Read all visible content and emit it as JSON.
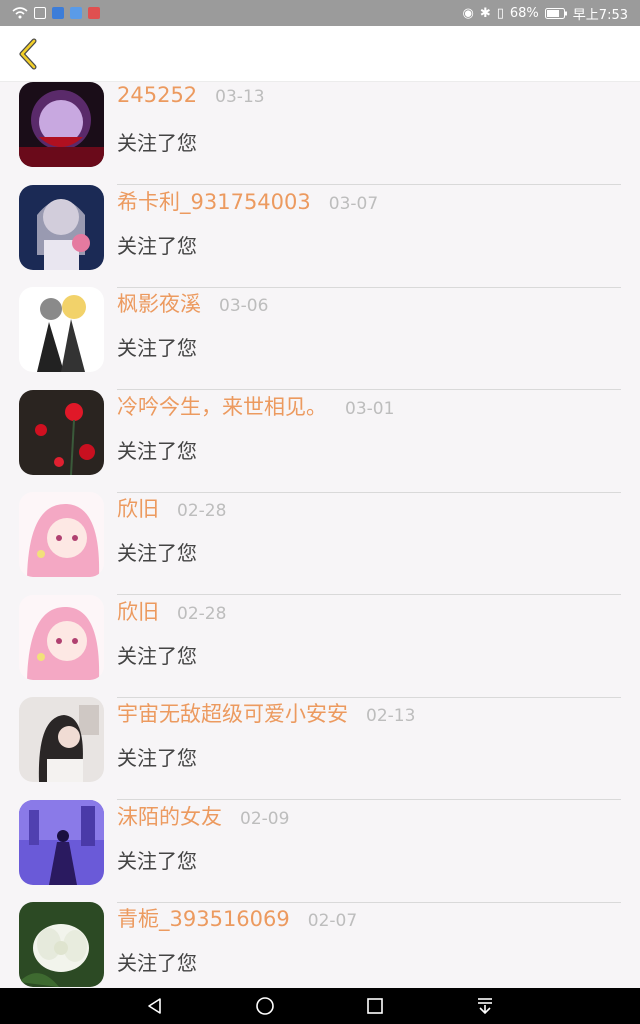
{
  "status_bar": {
    "battery": "68%",
    "time": "早上7:53"
  },
  "header": {
    "back_icon": "chevron-left-icon",
    "accent_color": "#e6b800"
  },
  "colors": {
    "name": "#ec9a5f",
    "date": "#bdbdbd",
    "action": "#444444"
  },
  "follows": [
    {
      "name": "245252",
      "date": "03-13",
      "action": "关注了您"
    },
    {
      "name": "希卡利_931754003",
      "date": "03-07",
      "action": "关注了您"
    },
    {
      "name": "枫影夜溪",
      "date": "03-06",
      "action": "关注了您"
    },
    {
      "name": "冷吟今生，来世相见。",
      "date": "03-01",
      "action": "关注了您"
    },
    {
      "name": "欣旧",
      "date": "02-28",
      "action": "关注了您"
    },
    {
      "name": "欣旧",
      "date": "02-28",
      "action": "关注了您"
    },
    {
      "name": "宇宙无敌超级可爱小安安",
      "date": "02-13",
      "action": "关注了您"
    },
    {
      "name": "沫陌的女友",
      "date": "02-09",
      "action": "关注了您"
    },
    {
      "name": "青栀_393516069",
      "date": "02-07",
      "action": "关注了您"
    }
  ],
  "nav_bar": {
    "back": "triangle-back-icon",
    "home": "circle-home-icon",
    "recents": "square-recents-icon",
    "notifications": "pull-down-icon"
  }
}
